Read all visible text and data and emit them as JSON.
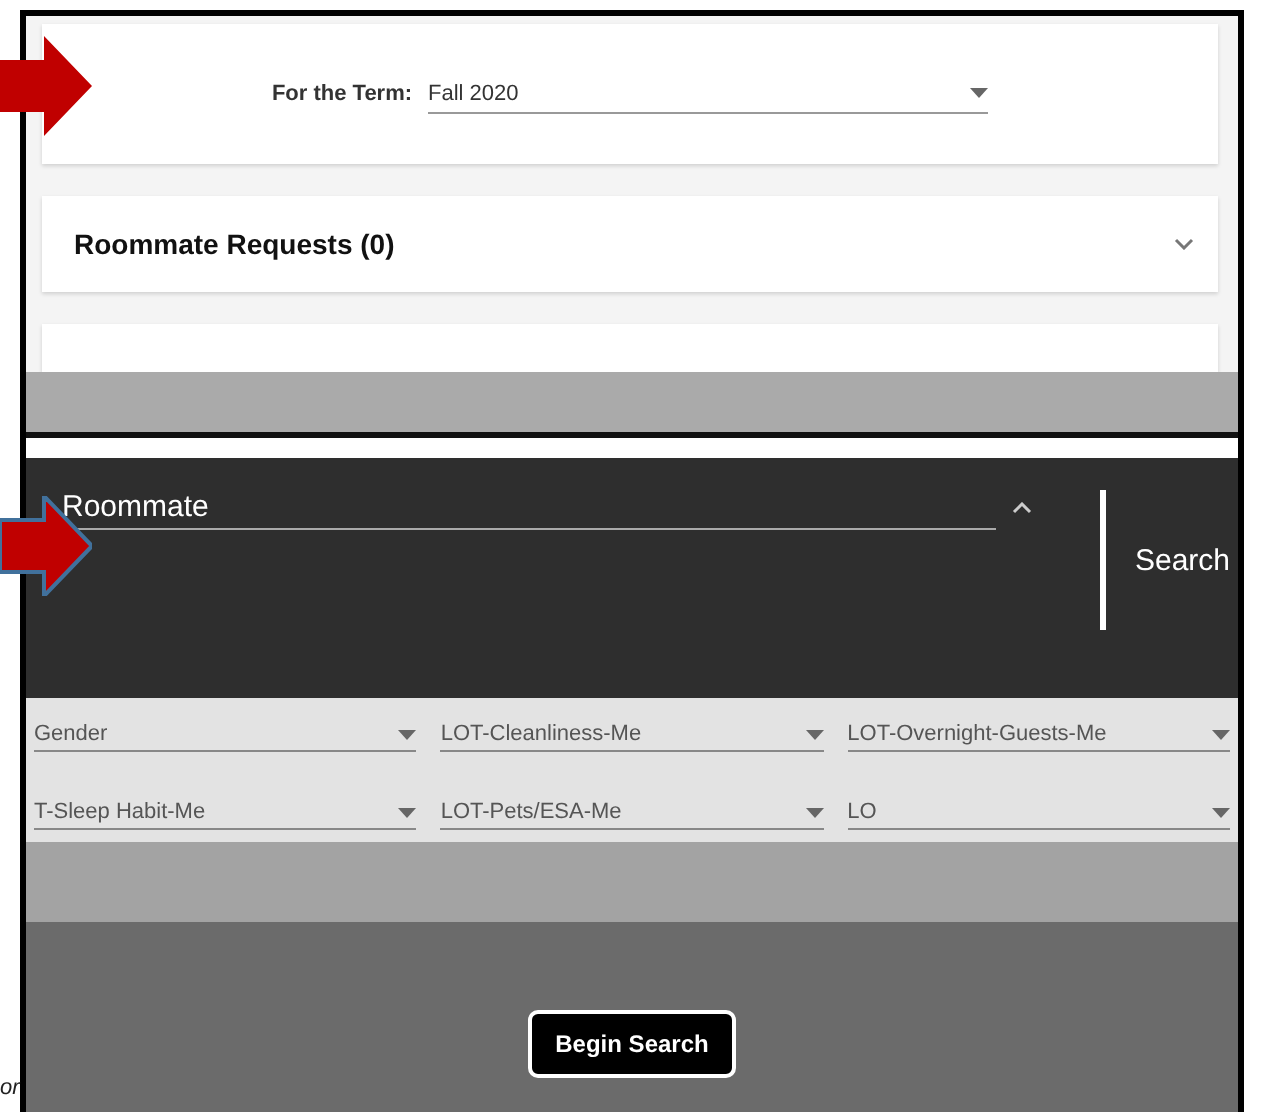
{
  "term": {
    "label": "For the Term:",
    "value": "Fall 2020"
  },
  "sections": [
    {
      "title": "Roommate Requests (0)",
      "expanded": false
    }
  ],
  "search_panel": {
    "title": "Roommate",
    "action": "Search",
    "fields": [
      {
        "label": "Gender"
      },
      {
        "label": "LOT-Cleanliness-Me"
      },
      {
        "label": "LOT-Overnight-Guests-Me"
      },
      {
        "label": "T-Sleep Habit-Me"
      },
      {
        "label": "LOT-Pets/ESA-Me"
      },
      {
        "label": "LO"
      }
    ]
  },
  "button": "Begin Search",
  "side_note": "or"
}
